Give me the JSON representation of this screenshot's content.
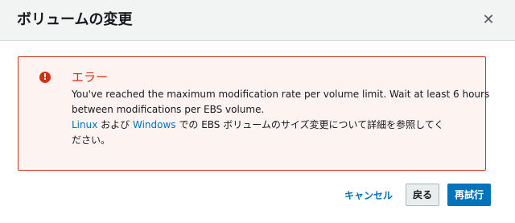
{
  "modal": {
    "title": "ボリュームの変更",
    "close_icon": "close-icon"
  },
  "alert": {
    "icon": "error-icon",
    "title": "エラー",
    "message_line1": "You've reached the maximum modification rate per volume limit. Wait at least 6 hours",
    "message_line2": "between modifications per EBS volume.",
    "linux_link": "Linux",
    "and_text": " および ",
    "windows_link": "Windows",
    "tail_text": " での EBS ボリュームのサイズ変更について詳細を参照してく",
    "tail_text2": "ださい。"
  },
  "buttons": {
    "cancel": "キャンセル",
    "back": "戻る",
    "retry": "再試行"
  },
  "colors": {
    "error": "#d13212",
    "link": "#0073bb",
    "header_bg": "#f2f3f3"
  }
}
